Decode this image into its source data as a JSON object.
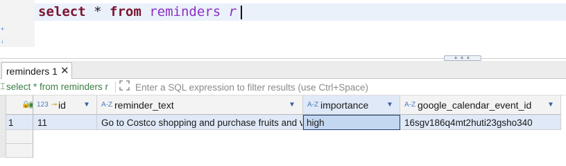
{
  "editor": {
    "keyword_select": "select",
    "operator_star": "*",
    "keyword_from": "from",
    "table_name": "reminders",
    "alias": "r"
  },
  "result_tab": {
    "label": "reminders 1",
    "close": "✕"
  },
  "filter_bar": {
    "query_text": "select * from reminders r",
    "placeholder": "Enter a SQL expression to filter results (use Ctrl+Space)"
  },
  "grid": {
    "columns": [
      {
        "name": "id",
        "type_icon": "123",
        "key_icon": "key-icon"
      },
      {
        "name": "reminder_text",
        "type_icon": "A-Z"
      },
      {
        "name": "importance",
        "type_icon": "A-Z"
      },
      {
        "name": "google_calendar_event_id",
        "type_icon": "A-Z"
      }
    ],
    "rows": [
      {
        "row_number": "1",
        "id": "11",
        "reminder_text": "Go to Costco shopping and purchase fruits and v",
        "importance": "high",
        "google_calendar_event_id": "16sgv186q4mt2huti23gsho340"
      }
    ]
  },
  "colors": {
    "keyword": "#7b1430",
    "identifier": "#8a2fc2",
    "query_green": "#3a7d44",
    "selection": "#c3d7f1"
  }
}
